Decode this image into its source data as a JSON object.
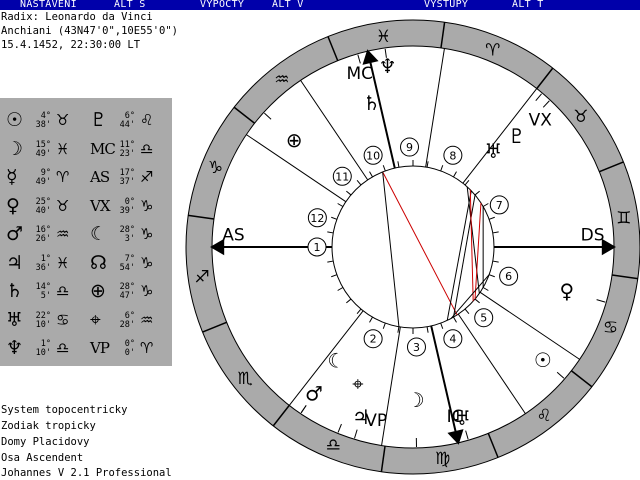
{
  "menu": [
    {
      "id": "nastaveni",
      "label": "NASTAVENI"
    },
    {
      "id": "alt-s",
      "label": "ALT S"
    },
    {
      "id": "vypocty",
      "label": "VYPOCTY"
    },
    {
      "id": "alt-v",
      "label": "ALT V"
    },
    {
      "id": "vystupy",
      "label": "VYSTUPY"
    },
    {
      "id": "alt-t",
      "label": "ALT T"
    }
  ],
  "header": {
    "radix": "Radix: Leonardo da Vinci",
    "place": "Anchiani (43N47'0\",10E55'0\")",
    "datetime": "15.4.1452, 22:30:00 LT"
  },
  "planets": [
    {
      "name": "sun",
      "glyph": "☉",
      "deg": "4°",
      "min": "38'",
      "sign": "♉"
    },
    {
      "name": "moon",
      "glyph": "☽",
      "deg": "15°",
      "min": "49'",
      "sign": "♓"
    },
    {
      "name": "mercury",
      "glyph": "☿",
      "deg": "9°",
      "min": "49'",
      "sign": "♈"
    },
    {
      "name": "venus",
      "glyph": "♀",
      "deg": "25°",
      "min": "40'",
      "sign": "♉"
    },
    {
      "name": "mars",
      "glyph": "♂",
      "deg": "16°",
      "min": "26'",
      "sign": "♒"
    },
    {
      "name": "jupiter",
      "glyph": "♃",
      "deg": "1°",
      "min": "36'",
      "sign": "♓"
    },
    {
      "name": "saturn",
      "glyph": "♄",
      "deg": "14°",
      "min": "5'",
      "sign": "♎"
    },
    {
      "name": "uranus",
      "glyph": "♅",
      "deg": "22°",
      "min": "10'",
      "sign": "♋"
    },
    {
      "name": "neptune",
      "glyph": "♆",
      "deg": "1°",
      "min": "10'",
      "sign": "♎"
    },
    {
      "name": "pluto",
      "glyph": "♇",
      "deg": "6°",
      "min": "44'",
      "sign": "♌"
    },
    {
      "name": "mc",
      "glyph": "MC",
      "deg": "11°",
      "min": "23'",
      "sign": "♎"
    },
    {
      "name": "as",
      "glyph": "AS",
      "deg": "17°",
      "min": "37'",
      "sign": "♐"
    },
    {
      "name": "vx",
      "glyph": "VX",
      "deg": "0°",
      "min": "39'",
      "sign": "♑"
    },
    {
      "name": "lilith",
      "glyph": "☾",
      "deg": "28°",
      "min": "3'",
      "sign": "♑"
    },
    {
      "name": "node",
      "glyph": "☊",
      "deg": "7°",
      "min": "54'",
      "sign": "♑"
    },
    {
      "name": "fortune",
      "glyph": "⊕",
      "deg": "28°",
      "min": "47'",
      "sign": "♑"
    },
    {
      "name": "part",
      "glyph": "⌖",
      "deg": "6°",
      "min": "28'",
      "sign": "♒"
    },
    {
      "name": "vp",
      "glyph": "VP",
      "deg": "0°",
      "min": "0'",
      "sign": "♈"
    }
  ],
  "footer": {
    "system": "System topocentricky",
    "zodiac": "Zodiak tropicky",
    "houses": "Domy Placidovy",
    "axis": "Osa Ascendent",
    "product": "Johannes V 2.1 Professional"
  },
  "wheel": {
    "house_numbers": [
      "1",
      "2",
      "3",
      "4",
      "5",
      "6",
      "7",
      "8",
      "9",
      "10",
      "11",
      "12"
    ],
    "axis_labels": {
      "as": "AS",
      "ds": "DS",
      "mc": "MC",
      "ic": "IC",
      "vx": "VX",
      "vp": "VP"
    },
    "zodiac_ring_signs": [
      "♑",
      "♐",
      "♏",
      "♎",
      "♍",
      "♌",
      "♋",
      "♊",
      "♉",
      "♈",
      "♓",
      "♒"
    ],
    "chart_planet_glyphs": [
      "♆",
      "♄",
      "⊕",
      "♇",
      "♅",
      "☉",
      "♀",
      "☾",
      "⌖",
      "♂",
      "♃",
      "☽",
      "♅"
    ],
    "colors": {
      "ring": "#aaaaaa",
      "aspect_red": "#cc0000",
      "aspect_black": "#000000",
      "menu": "#0000aa"
    }
  }
}
